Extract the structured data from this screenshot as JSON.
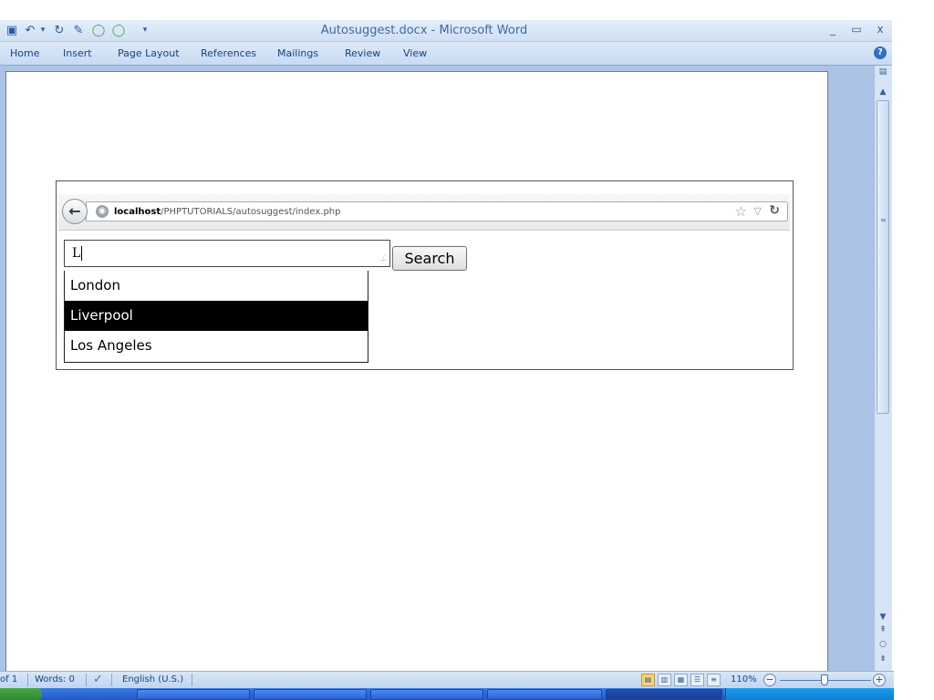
{
  "window": {
    "title": "Autosuggest.docx - Microsoft Word",
    "minimize": "_",
    "restore": "▭",
    "close": "x"
  },
  "quick_access": [
    {
      "icon": "save-icon",
      "glyph": "▣"
    },
    {
      "icon": "undo-icon",
      "glyph": "↶"
    },
    {
      "icon": "undo-dropdown-icon",
      "glyph": "▾"
    },
    {
      "icon": "redo-icon",
      "glyph": "↻"
    },
    {
      "icon": "new-document-icon",
      "glyph": "✎"
    },
    {
      "icon": "circle-icon",
      "glyph": "◯"
    },
    {
      "icon": "circle-icon",
      "glyph": "◯"
    },
    {
      "icon": "customize-qat-icon",
      "glyph": "▾"
    }
  ],
  "ribbon": {
    "tabs": [
      "Home",
      "Insert",
      "Page Layout",
      "References",
      "Mailings",
      "Review",
      "View"
    ],
    "help": "?"
  },
  "browser": {
    "url_host": "localhost",
    "url_path": "/PHPTUTORIALS/autosuggest/index.php",
    "search_value": "L",
    "search_button": "Search",
    "suggestions": [
      "London",
      "Liverpool",
      "Los Angeles"
    ],
    "active_suggestion": "Liverpool"
  },
  "status": {
    "page": "of 1",
    "words": "Words: 0",
    "language": "English (U.S.)",
    "zoom": "110%",
    "zoom_minus": "−",
    "zoom_plus": "+"
  },
  "colors": {
    "word_blue": "#15428b",
    "active_row_bg": "#000000",
    "active_row_fg": "#ffffff"
  }
}
